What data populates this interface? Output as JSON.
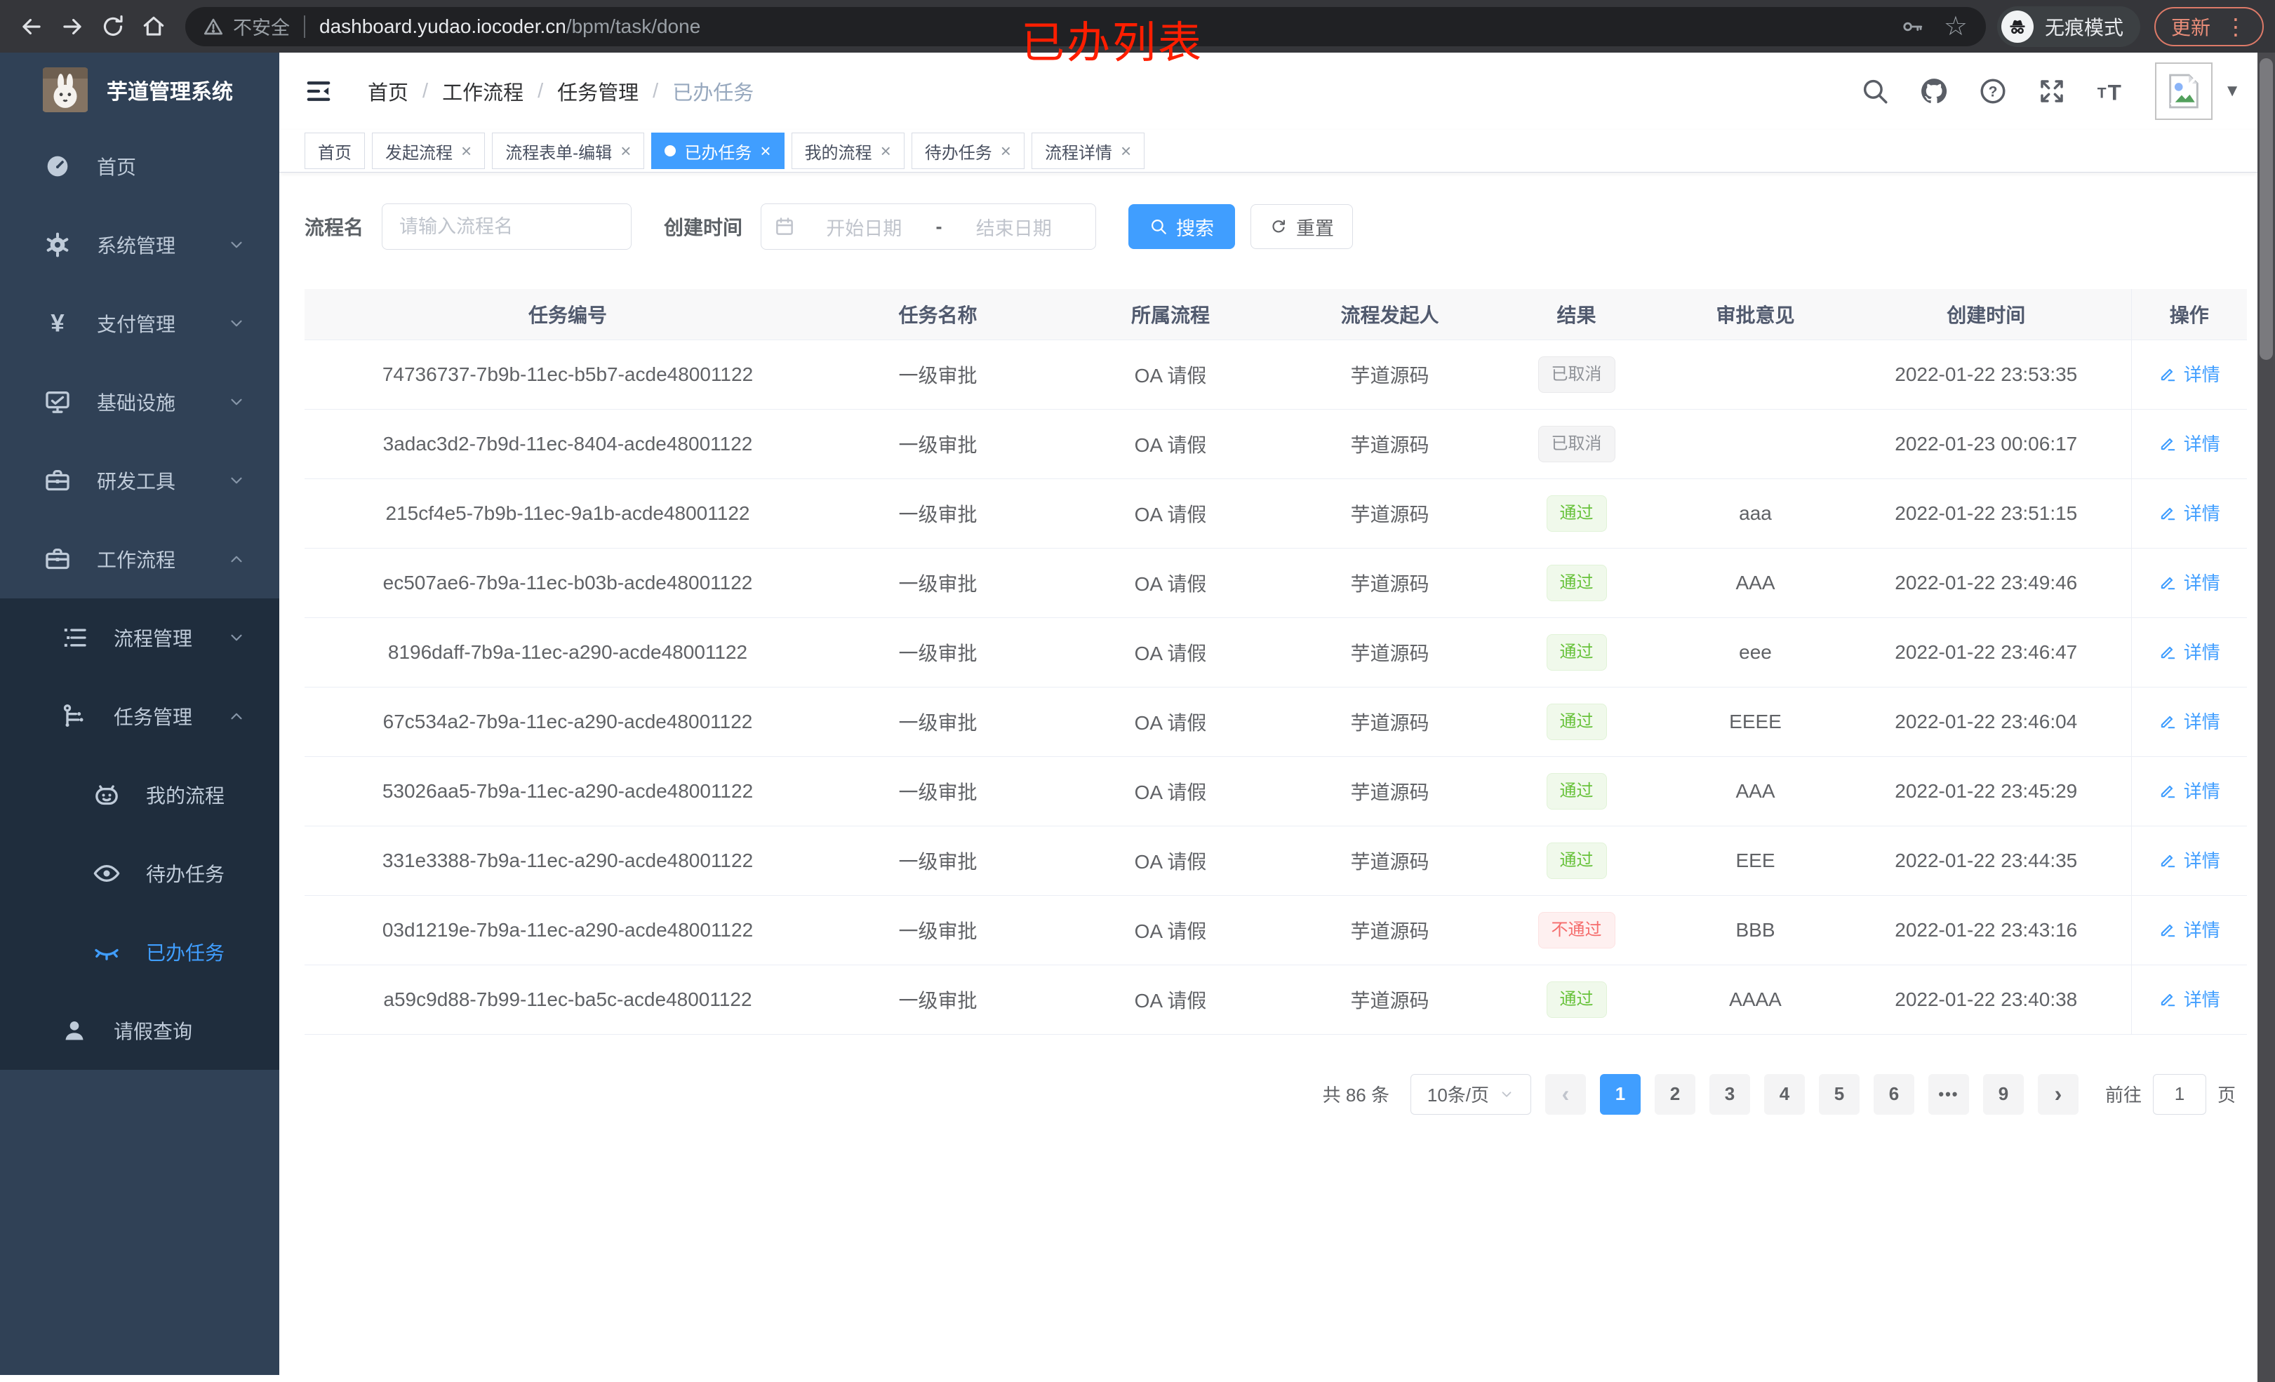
{
  "browser": {
    "security_label": "不安全",
    "url_host": "dashboard.yudao.iocoder.cn",
    "url_path": "/bpm/task/done",
    "incognito_label": "无痕模式",
    "update_label": "更新"
  },
  "annotation": {
    "text": "已办列表",
    "color": "#ff1e00"
  },
  "sidebar": {
    "logo_title": "芋道管理系统",
    "menu": [
      {
        "label": "首页",
        "icon": "dashboard-icon",
        "level": 0,
        "submenu": false,
        "chevron": "",
        "active": false
      },
      {
        "label": "系统管理",
        "icon": "gear-icon",
        "level": 0,
        "submenu": false,
        "chevron": "down",
        "active": false
      },
      {
        "label": "支付管理",
        "icon": "yen-icon",
        "level": 0,
        "submenu": false,
        "chevron": "down",
        "active": false
      },
      {
        "label": "基础设施",
        "icon": "monitor-icon",
        "level": 0,
        "submenu": false,
        "chevron": "down",
        "active": false
      },
      {
        "label": "研发工具",
        "icon": "toolbox-icon",
        "level": 0,
        "submenu": false,
        "chevron": "down",
        "active": false
      },
      {
        "label": "工作流程",
        "icon": "briefcase-icon",
        "level": 0,
        "submenu": false,
        "chevron": "up",
        "active": false
      },
      {
        "label": "流程管理",
        "icon": "list-icon",
        "level": 1,
        "submenu": true,
        "chevron": "down",
        "active": false
      },
      {
        "label": "任务管理",
        "icon": "flow-icon",
        "level": 1,
        "submenu": true,
        "chevron": "up",
        "active": false
      },
      {
        "label": "我的流程",
        "icon": "robot-icon",
        "level": 2,
        "submenu": true,
        "chevron": "",
        "active": false
      },
      {
        "label": "待办任务",
        "icon": "eye-icon",
        "level": 2,
        "submenu": true,
        "chevron": "",
        "active": false
      },
      {
        "label": "已办任务",
        "icon": "eye-closed-icon",
        "level": 2,
        "submenu": true,
        "chevron": "",
        "active": true
      },
      {
        "label": "请假查询",
        "icon": "user-icon",
        "level": 1,
        "submenu": true,
        "chevron": "",
        "active": false
      }
    ]
  },
  "header": {
    "breadcrumb": [
      "首页",
      "工作流程",
      "任务管理",
      "已办任务"
    ]
  },
  "tabs": [
    {
      "label": "首页",
      "closable": false,
      "active": false
    },
    {
      "label": "发起流程",
      "closable": true,
      "active": false
    },
    {
      "label": "流程表单-编辑",
      "closable": true,
      "active": false
    },
    {
      "label": "已办任务",
      "closable": true,
      "active": true
    },
    {
      "label": "我的流程",
      "closable": true,
      "active": false
    },
    {
      "label": "待办任务",
      "closable": true,
      "active": false
    },
    {
      "label": "流程详情",
      "closable": true,
      "active": false
    }
  ],
  "filter": {
    "name_label": "流程名",
    "name_placeholder": "请输入流程名",
    "date_label": "创建时间",
    "date_start_placeholder": "开始日期",
    "date_separator": "-",
    "date_end_placeholder": "结束日期",
    "search_label": "搜索",
    "reset_label": "重置"
  },
  "table": {
    "columns": [
      "任务编号",
      "任务名称",
      "所属流程",
      "流程发起人",
      "结果",
      "审批意见",
      "创建时间",
      "操作"
    ],
    "action_label": "详情",
    "result_styles": {
      "info": {
        "bg": "#f4f4f5",
        "color": "#909399",
        "border": "#e9e9eb"
      },
      "success": {
        "bg": "#f0f9eb",
        "color": "#67c23a",
        "border": "#e1f3d8"
      },
      "danger": {
        "bg": "#fef0f0",
        "color": "#f56c6c",
        "border": "#fde2e2"
      }
    },
    "rows": [
      {
        "id": "74736737-7b9b-11ec-b5b7-acde48001122",
        "name": "一级审批",
        "process": "OA 请假",
        "starter": "芋道源码",
        "result": "已取消",
        "result_type": "info",
        "opinion": "",
        "created": "2022-01-22 23:53:35"
      },
      {
        "id": "3adac3d2-7b9d-11ec-8404-acde48001122",
        "name": "一级审批",
        "process": "OA 请假",
        "starter": "芋道源码",
        "result": "已取消",
        "result_type": "info",
        "opinion": "",
        "created": "2022-01-23 00:06:17"
      },
      {
        "id": "215cf4e5-7b9b-11ec-9a1b-acde48001122",
        "name": "一级审批",
        "process": "OA 请假",
        "starter": "芋道源码",
        "result": "通过",
        "result_type": "success",
        "opinion": "aaa",
        "created": "2022-01-22 23:51:15"
      },
      {
        "id": "ec507ae6-7b9a-11ec-b03b-acde48001122",
        "name": "一级审批",
        "process": "OA 请假",
        "starter": "芋道源码",
        "result": "通过",
        "result_type": "success",
        "opinion": "AAA",
        "created": "2022-01-22 23:49:46"
      },
      {
        "id": "8196daff-7b9a-11ec-a290-acde48001122",
        "name": "一级审批",
        "process": "OA 请假",
        "starter": "芋道源码",
        "result": "通过",
        "result_type": "success",
        "opinion": "eee",
        "created": "2022-01-22 23:46:47"
      },
      {
        "id": "67c534a2-7b9a-11ec-a290-acde48001122",
        "name": "一级审批",
        "process": "OA 请假",
        "starter": "芋道源码",
        "result": "通过",
        "result_type": "success",
        "opinion": "EEEE",
        "created": "2022-01-22 23:46:04"
      },
      {
        "id": "53026aa5-7b9a-11ec-a290-acde48001122",
        "name": "一级审批",
        "process": "OA 请假",
        "starter": "芋道源码",
        "result": "通过",
        "result_type": "success",
        "opinion": "AAA",
        "created": "2022-01-22 23:45:29"
      },
      {
        "id": "331e3388-7b9a-11ec-a290-acde48001122",
        "name": "一级审批",
        "process": "OA 请假",
        "starter": "芋道源码",
        "result": "通过",
        "result_type": "success",
        "opinion": "EEE",
        "created": "2022-01-22 23:44:35"
      },
      {
        "id": "03d1219e-7b9a-11ec-a290-acde48001122",
        "name": "一级审批",
        "process": "OA 请假",
        "starter": "芋道源码",
        "result": "不通过",
        "result_type": "danger",
        "opinion": "BBB",
        "created": "2022-01-22 23:43:16"
      },
      {
        "id": "a59c9d88-7b99-11ec-ba5c-acde48001122",
        "name": "一级审批",
        "process": "OA 请假",
        "starter": "芋道源码",
        "result": "通过",
        "result_type": "success",
        "opinion": "AAAA",
        "created": "2022-01-22 23:40:38"
      }
    ]
  },
  "pagination": {
    "total_label": "共 86 条",
    "page_size": "10条/页",
    "pages": [
      "1",
      "2",
      "3",
      "4",
      "5",
      "6",
      "...",
      "9"
    ],
    "active_page": "1",
    "goto_label": "前往",
    "goto_value": "1",
    "page_unit": "页"
  },
  "colors": {
    "primary": "#409eff",
    "sidebar_bg": "#304156",
    "submenu_bg": "#1f2d3d"
  }
}
